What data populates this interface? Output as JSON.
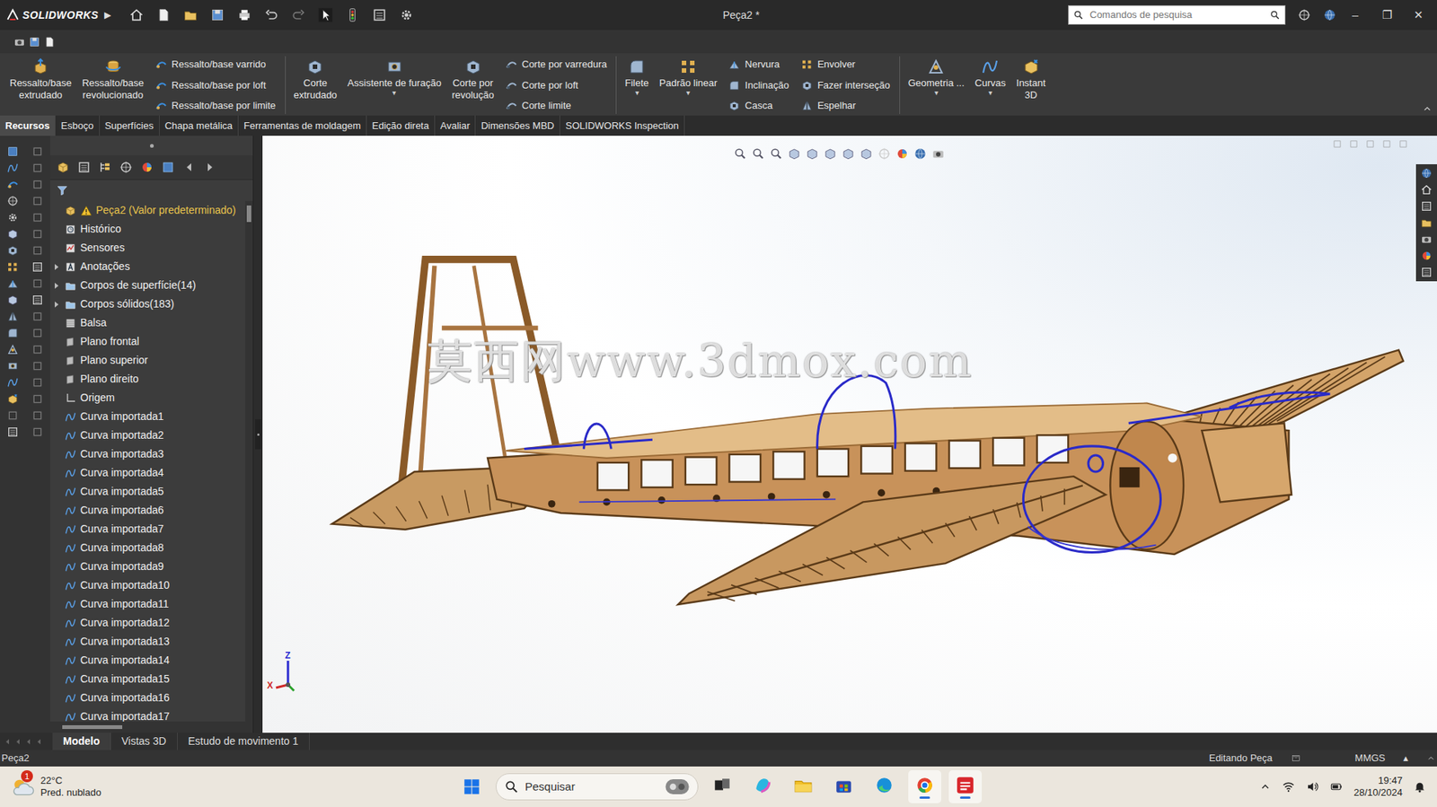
{
  "titlebar": {
    "logo": "SOLIDWORKS",
    "menu_arrow": "▶",
    "title": "Peça2 *",
    "search": {
      "placeholder": "Comandos de pesquisa"
    },
    "controls": [
      "–",
      "❐",
      "✕"
    ]
  },
  "ribbon": {
    "items": [
      {
        "kind": "large",
        "lines": [
          "Ressalto/base",
          "extrudado"
        ]
      },
      {
        "kind": "large",
        "lines": [
          "Ressalto/base",
          "revolucionado"
        ]
      },
      {
        "kind": "stack",
        "entries": [
          "Ressalto/base varrido",
          "Ressalto/base por loft",
          "Ressalto/base por limite"
        ]
      },
      {
        "kind": "separator"
      },
      {
        "kind": "large",
        "lines": [
          "Corte",
          "extrudado"
        ]
      },
      {
        "kind": "large",
        "lines": [
          "Assistente de furação"
        ],
        "caret": "▾"
      },
      {
        "kind": "large",
        "lines": [
          "Corte por",
          "revolução"
        ]
      },
      {
        "kind": "stack",
        "entries": [
          "Corte por varredura",
          "Corte por loft",
          "Corte limite"
        ]
      },
      {
        "kind": "separator"
      },
      {
        "kind": "large",
        "lines": [
          "Filete"
        ],
        "caret": "▾"
      },
      {
        "kind": "large",
        "lines": [
          "Padrão linear"
        ],
        "caret": "▾"
      },
      {
        "kind": "stack",
        "entries": [
          "Nervura",
          "Inclinação",
          "Casca"
        ]
      },
      {
        "kind": "stack",
        "entries": [
          "Envolver",
          "Fazer interseção",
          "Espelhar"
        ]
      },
      {
        "kind": "separator"
      },
      {
        "kind": "large",
        "lines": [
          "Geometria ..."
        ],
        "caret": "▾"
      },
      {
        "kind": "large",
        "lines": [
          "Curvas"
        ],
        "caret": "▾"
      },
      {
        "kind": "large",
        "lines": [
          "Instant",
          "3D"
        ]
      }
    ]
  },
  "tabs": [
    {
      "label": "Recursos",
      "selected": true
    },
    {
      "label": "Esboço",
      "selected": false
    },
    {
      "label": "Superfícies",
      "selected": false
    },
    {
      "label": "Chapa metálica",
      "selected": false
    },
    {
      "label": "Ferramentas de moldagem",
      "selected": false
    },
    {
      "label": "Edição direta",
      "selected": false
    },
    {
      "label": "Avaliar",
      "selected": false
    },
    {
      "label": "Dimensões MBD",
      "selected": false
    },
    {
      "label": "SOLIDWORKS Inspection",
      "selected": false
    }
  ],
  "tree": {
    "items": [
      {
        "label": "Peça2 (Valor predeterminado)",
        "kind": "part",
        "warning": true,
        "expandable": false,
        "expanded": false
      },
      {
        "label": "Histórico",
        "kind": "history",
        "warning": false,
        "expandable": false,
        "expanded": false
      },
      {
        "label": "Sensores",
        "kind": "sensor",
        "warning": false,
        "expandable": false,
        "expanded": false
      },
      {
        "label": "Anotações",
        "kind": "annotation",
        "warning": false,
        "expandable": true,
        "expanded": false
      },
      {
        "label": "Corpos de superfície(14)",
        "kind": "bodies",
        "warning": false,
        "expandable": true,
        "expanded": false
      },
      {
        "label": "Corpos sólidos(183)",
        "kind": "bodies",
        "warning": false,
        "expandable": true,
        "expanded": false
      },
      {
        "label": "Balsa",
        "kind": "material",
        "warning": false,
        "expandable": false,
        "expanded": false
      },
      {
        "label": "Plano frontal",
        "kind": "plane",
        "warning": false,
        "expandable": false,
        "expanded": false
      },
      {
        "label": "Plano superior",
        "kind": "plane",
        "warning": false,
        "expandable": false,
        "expanded": false
      },
      {
        "label": "Plano direito",
        "kind": "plane",
        "warning": false,
        "expandable": false,
        "expanded": false
      },
      {
        "label": "Origem",
        "kind": "origin",
        "warning": false,
        "expandable": false,
        "expanded": false
      },
      {
        "label": "Curva importada1",
        "kind": "curve",
        "warning": false,
        "expandable": false,
        "expanded": false
      },
      {
        "label": "Curva importada2",
        "kind": "curve",
        "warning": false,
        "expandable": false,
        "expanded": false
      },
      {
        "label": "Curva importada3",
        "kind": "curve",
        "warning": false,
        "expandable": false,
        "expanded": false
      },
      {
        "label": "Curva importada4",
        "kind": "curve",
        "warning": false,
        "expandable": false,
        "expanded": false
      },
      {
        "label": "Curva importada5",
        "kind": "curve",
        "warning": false,
        "expandable": false,
        "expanded": false
      },
      {
        "label": "Curva importada6",
        "kind": "curve",
        "warning": false,
        "expandable": false,
        "expanded": false
      },
      {
        "label": "Curva importada7",
        "kind": "curve",
        "warning": false,
        "expandable": false,
        "expanded": false
      },
      {
        "label": "Curva importada8",
        "kind": "curve",
        "warning": false,
        "expandable": false,
        "expanded": false
      },
      {
        "label": "Curva importada9",
        "kind": "curve",
        "warning": false,
        "expandable": false,
        "expanded": false
      },
      {
        "label": "Curva importada10",
        "kind": "curve",
        "warning": false,
        "expandable": false,
        "expanded": false
      },
      {
        "label": "Curva importada11",
        "kind": "curve",
        "warning": false,
        "expandable": false,
        "expanded": false
      },
      {
        "label": "Curva importada12",
        "kind": "curve",
        "warning": false,
        "expandable": false,
        "expanded": false
      },
      {
        "label": "Curva importada13",
        "kind": "curve",
        "warning": false,
        "expandable": false,
        "expanded": false
      },
      {
        "label": "Curva importada14",
        "kind": "curve",
        "warning": false,
        "expandable": false,
        "expanded": false
      },
      {
        "label": "Curva importada15",
        "kind": "curve",
        "warning": false,
        "expandable": false,
        "expanded": false
      },
      {
        "label": "Curva importada16",
        "kind": "curve",
        "warning": false,
        "expandable": false,
        "expanded": false
      },
      {
        "label": "Curva importada17",
        "kind": "curve",
        "warning": false,
        "expandable": false,
        "expanded": false
      }
    ]
  },
  "viewport": {
    "watermark": "莫西网www.3dmox.com",
    "axes": {
      "z": "Z",
      "x": "X"
    }
  },
  "bottom_tabs": [
    {
      "label": "Modelo",
      "selected": true
    },
    {
      "label": "Vistas 3D",
      "selected": false
    },
    {
      "label": "Estudo de movimento 1",
      "selected": false
    }
  ],
  "status_bar": {
    "document": "Peça2",
    "mode": "Editando Peça",
    "units": "MMGS",
    "units_caret": "▴"
  },
  "taskbar": {
    "weather": {
      "badge": "1",
      "temperature": "22°C",
      "description": "Pred. nublado"
    },
    "search": "Pesquisar",
    "apps": [
      {
        "active": false
      },
      {
        "active": false
      },
      {
        "active": false
      },
      {
        "active": false
      },
      {
        "active": false
      },
      {
        "active": true
      },
      {
        "active": true
      }
    ],
    "clock": {
      "time": "19:47",
      "date": "28/10/2024"
    }
  }
}
